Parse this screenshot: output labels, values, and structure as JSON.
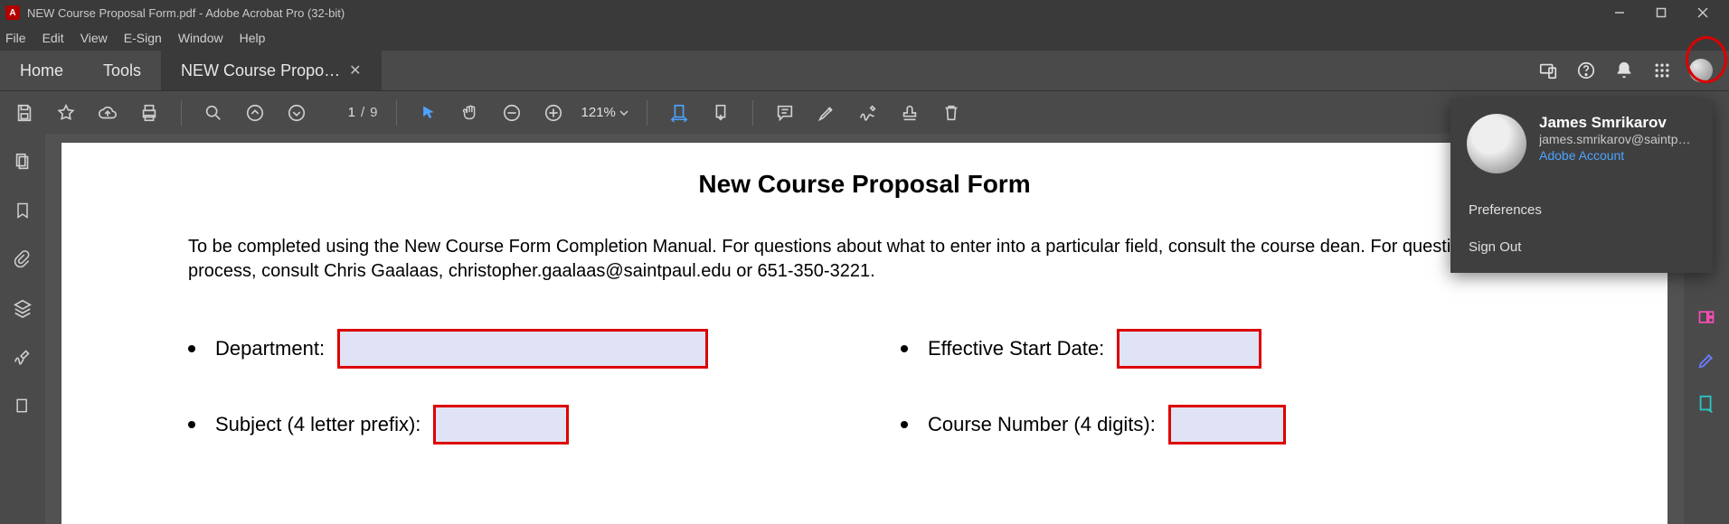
{
  "window": {
    "title": "NEW Course Proposal Form.pdf - Adobe Acrobat Pro (32-bit)"
  },
  "menu": {
    "file": "File",
    "edit": "Edit",
    "view": "View",
    "esign": "E-Sign",
    "window": "Window",
    "help": "Help"
  },
  "tabs": {
    "home": "Home",
    "tools": "Tools",
    "doc": "NEW Course Propo…"
  },
  "toolbar": {
    "page_current": "1",
    "page_sep": "/",
    "page_total": "9",
    "zoom": "121%"
  },
  "account_popup": {
    "name": "James Smrikarov",
    "email": "james.smrikarov@saintpa…",
    "link": "Adobe Account",
    "preferences": "Preferences",
    "signout": "Sign Out"
  },
  "doc": {
    "title": "New Course Proposal Form",
    "intro": "To be completed using the New Course Form Completion Manual. For questions about what to enter into a particular field, consult the course dean. For questions about process, consult Chris Gaalaas, christopher.gaalaas@saintpaul.edu or 651-350-3221.",
    "department_label": "Department:",
    "subject_label": "Subject (4 letter prefix):",
    "startdate_label": "Effective Start Date:",
    "coursenum_label": "Course Number (4 digits):"
  }
}
